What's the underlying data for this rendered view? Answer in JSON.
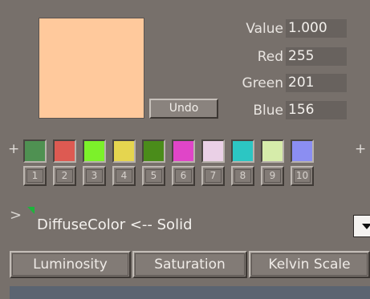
{
  "color": {
    "preview_hex": "#ffc99c",
    "undo_label": "Undo",
    "fields": [
      {
        "label": "Value",
        "value": "1.000"
      },
      {
        "label": "Red",
        "value": "255"
      },
      {
        "label": "Green",
        "value": "201"
      },
      {
        "label": "Blue",
        "value": "156"
      }
    ]
  },
  "palette": {
    "plus_left": "+",
    "plus_right": "+",
    "swatches": [
      {
        "color": "#4f9152",
        "number": "1"
      },
      {
        "color": "#dd5a52",
        "number": "2"
      },
      {
        "color": "#7cf12a",
        "number": "3"
      },
      {
        "color": "#e5d54f",
        "number": "4"
      },
      {
        "color": "#4a8c1a",
        "number": "5"
      },
      {
        "color": "#e045c8",
        "number": "6"
      },
      {
        "color": "#ead0e6",
        "number": "7"
      },
      {
        "color": "#2cc6c3",
        "number": "8"
      },
      {
        "color": "#d6ecaa",
        "number": "9"
      },
      {
        "color": "#8b8ef2",
        "number": "10"
      }
    ]
  },
  "property": {
    "expander_icon": "chevron-right-icon",
    "label": "DiffuseColor <-- Solid",
    "dropdown_icon": "dropdown-arrow-icon"
  },
  "tabs": [
    {
      "label": "Luminosity"
    },
    {
      "label": "Saturation"
    },
    {
      "label": "Kelvin Scale"
    }
  ]
}
